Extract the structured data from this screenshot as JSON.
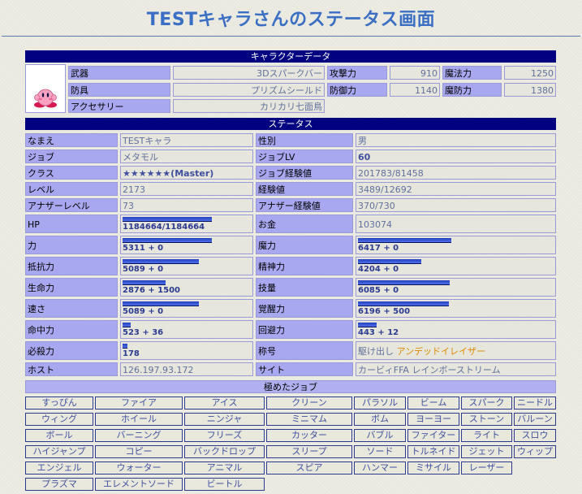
{
  "title": "TESTキャラさんのステータス画面",
  "sections": {
    "char": "キャラクターデータ",
    "status": "ステータス",
    "jobs": "極めたジョブ"
  },
  "equip": {
    "weapon_label": "武器",
    "weapon": "3Dスパークバー",
    "armor_label": "防具",
    "armor": "プリズムシールド",
    "acc_label": "アクセサリー",
    "acc": "カリカリ七面鳥",
    "atk_label": "攻撃力",
    "atk": "910",
    "def_label": "防御力",
    "def": "1140",
    "mag_label": "魔法力",
    "mag": "1250",
    "mdef_label": "魔防力",
    "mdef": "1380"
  },
  "status": {
    "name_label": "なまえ",
    "name": "TESTキャラ",
    "sex_label": "性別",
    "sex": "男",
    "job_label": "ジョブ",
    "job": "メタモル",
    "joblv_label": "ジョブLV",
    "joblv": "60",
    "class_label": "クラス",
    "class": "★★★★★★(Master)",
    "jobexp_label": "ジョブ経験値",
    "jobexp": "201783/81458",
    "level_label": "レベル",
    "level": "2173",
    "exp_label": "経験値",
    "exp": "3489/12692",
    "alevel_label": "アナザーレベル",
    "alevel": "73",
    "aexp_label": "アナザー経験値",
    "aexp": "370/730",
    "hp_label": "HP",
    "hp": "1184664/1184664",
    "hp_pct": 100,
    "gold_label": "お金",
    "gold": "103074",
    "str_label": "力",
    "str": "5311 + 0",
    "str_pct": 100,
    "magic_label": "魔力",
    "magic": "6417 + 0",
    "magic_pct": 100,
    "res_label": "抵抗力",
    "res": "5089 + 0",
    "res_pct": 85,
    "spirit_label": "精神力",
    "spirit": "4204 + 0",
    "spirit_pct": 68,
    "life_label": "生命力",
    "life": "2876 + 1500",
    "life_pct": 48,
    "skill_label": "技量",
    "skill": "6085 + 0",
    "skill_pct": 98,
    "spd_label": "速さ",
    "spd": "5089 + 0",
    "spd_pct": 85,
    "awake_label": "覚醒力",
    "awake": "6196 + 500",
    "awake_pct": 100,
    "hit_label": "命中力",
    "hit": "523 + 36",
    "hit_pct": 9,
    "eva_label": "回避力",
    "eva": "443 + 12",
    "eva_pct": 20,
    "crit_label": "必殺力",
    "crit": "178",
    "crit_pct": 5,
    "title_label": "称号",
    "title_pre": "駆け出し",
    "title_name": "アンデッドイレイザー",
    "host_label": "ホスト",
    "host": "126.197.93.172",
    "site_label": "サイト",
    "site": "カービィFFA レインボーストリーム"
  },
  "jobs": [
    [
      "すっぴん",
      "ファイア",
      "アイス",
      "クリーン",
      "パラソル",
      "ビーム",
      "スパーク",
      "ニードル"
    ],
    [
      "ウィング",
      "ホイール",
      "ニンジャ",
      "ミニマム",
      "ボム",
      "ヨーヨー",
      "ストーン",
      "バルーン"
    ],
    [
      "ボール",
      "バーニング",
      "フリーズ",
      "カッター",
      "バブル",
      "ファイター",
      "ライト",
      "スロウ"
    ],
    [
      "ハイジャンプ",
      "コピー",
      "バックドロップ",
      "スリープ",
      "ソード",
      "トルネイド",
      "ジェット",
      "ウィップ"
    ],
    [
      "エンジェル",
      "ウォーター",
      "アニマル",
      "スピア",
      "ハンマー",
      "ミサイル",
      "レーザー"
    ],
    [
      "プラズマ",
      "エレメントソード",
      "ビートル"
    ]
  ]
}
